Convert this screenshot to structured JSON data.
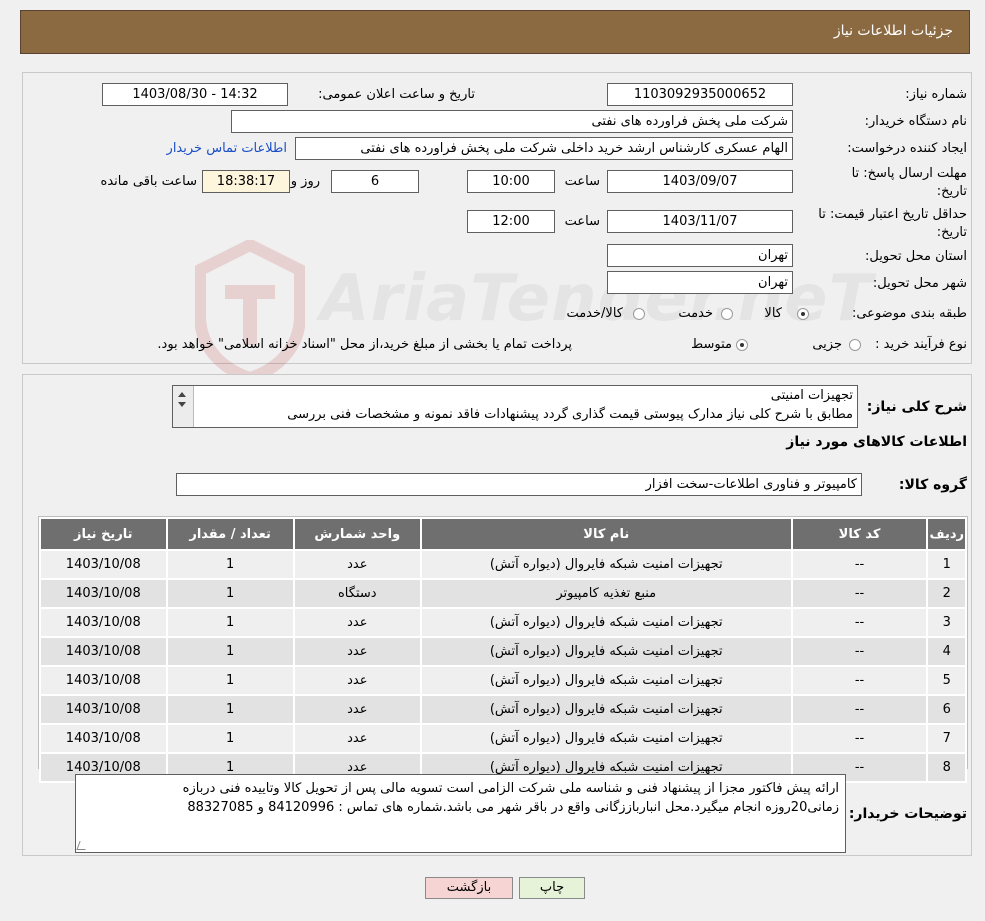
{
  "header": {
    "title": "جزئیات اطلاعات نیاز"
  },
  "info": {
    "need_number_label": "شماره نیاز:",
    "need_number": "1103092935000652",
    "announce_label": "تاریخ و ساعت اعلان عمومی:",
    "announce_value": "1403/08/30 - 14:32",
    "buyer_label": "نام دستگاه خریدار:",
    "buyer_value": "شرکت ملی پخش فراورده های نفتی",
    "creator_label": "ایجاد کننده درخواست:",
    "creator_value": "الهام عسکری کارشناس ارشد خرید داخلی شرکت ملی پخش فراورده های نفتی",
    "contact_link": "اطلاعات تماس خریدار",
    "deadline_label_1": "مهلت ارسال پاسخ: تا",
    "deadline_label_2": "تاریخ:",
    "deadline_date": "1403/09/07",
    "time_label": "ساعت",
    "deadline_time": "10:00",
    "remaining_days": "6",
    "days_label": "روز و",
    "remaining_time": "18:38:17",
    "remaining_label": "ساعت باقی مانده",
    "validity_label_1": "حداقل تاریخ اعتبار قیمت: تا",
    "validity_label_2": "تاریخ:",
    "validity_date": "1403/11/07",
    "validity_time": "12:00",
    "province_label": "استان محل تحویل:",
    "province_value": "تهران",
    "city_label": "شهر محل تحویل:",
    "city_value": "تهران",
    "category_label": "طبقه بندی موضوعی:",
    "category_options": [
      "کالا",
      "خدمت",
      "کالا/خدمت"
    ],
    "process_label": "نوع فرآیند خرید :",
    "process_options": [
      "جزیی",
      "متوسط"
    ],
    "payment_note": "پرداخت تمام یا بخشی از مبلغ خرید،از محل \"اسناد خزانه اسلامی\" خواهد بود."
  },
  "summary": {
    "label": "شرح کلی نیاز:",
    "line1": "تجهیزات امنیتی",
    "line2": "مطابق با شرح کلی نیاز مدارک پیوستی قیمت گذاری گردد پیشنهادات فاقد نمونه و مشخصات فنی بررسی",
    "items_title": "اطلاعات کالاهای مورد نیاز",
    "group_label": "گروه کالا:",
    "group_value": "کامپیوتر و فناوری اطلاعات-سخت افزار"
  },
  "table": {
    "headers": [
      "ردیف",
      "کد کالا",
      "نام کالا",
      "واحد شمارش",
      "تعداد / مقدار",
      "تاریخ نیاز"
    ],
    "rows": [
      [
        "1",
        "--",
        "تجهیزات امنیت شبکه فایروال (دیواره آتش)",
        "عدد",
        "1",
        "1403/10/08"
      ],
      [
        "2",
        "--",
        "منبع تغذیه کامپیوتر",
        "دستگاه",
        "1",
        "1403/10/08"
      ],
      [
        "3",
        "--",
        "تجهیزات امنیت شبکه فایروال (دیواره آتش)",
        "عدد",
        "1",
        "1403/10/08"
      ],
      [
        "4",
        "--",
        "تجهیزات امنیت شبکه فایروال (دیواره آتش)",
        "عدد",
        "1",
        "1403/10/08"
      ],
      [
        "5",
        "--",
        "تجهیزات امنیت شبکه فایروال (دیواره آتش)",
        "عدد",
        "1",
        "1403/10/08"
      ],
      [
        "6",
        "--",
        "تجهیزات امنیت شبکه فایروال (دیواره آتش)",
        "عدد",
        "1",
        "1403/10/08"
      ],
      [
        "7",
        "--",
        "تجهیزات امنیت شبکه فایروال (دیواره آتش)",
        "عدد",
        "1",
        "1403/10/08"
      ],
      [
        "8",
        "--",
        "تجهیزات امنیت شبکه فایروال (دیواره آتش)",
        "عدد",
        "1",
        "1403/10/08"
      ]
    ]
  },
  "buyer_notes": {
    "label": "توضیحات خریدار:",
    "line1": "ارائه پیش فاکتور مجزا از پیشنهاد فنی و شناسه ملی شرکت الزامی است تسویه مالی پس از تحویل کالا وتاییده فنی دربازه",
    "line2": "زمانی20روزه انجام میگیرد.محل انبارباززگانی واقع در باقر شهر می باشد.شماره های تماس : 84120996 و 88327085"
  },
  "buttons": {
    "print": "چاپ",
    "back": "بازگشت"
  },
  "watermark": {
    "text": "AriaTender.neT"
  },
  "colors": {
    "header_bg": "#8b6a42",
    "table_header_bg": "#6f6f6f",
    "back_button_bg": "#f7d4d4",
    "print_button_bg": "#e6f3d8",
    "link": "#1a4fc9"
  }
}
